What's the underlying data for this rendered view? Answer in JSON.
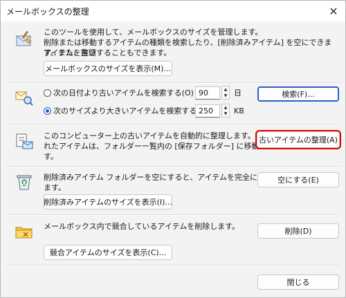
{
  "window": {
    "title": "メールボックスの整理",
    "close_glyph": "✕"
  },
  "sections": {
    "mailbox": {
      "line1": "このツールを使用して、メールボックスのサイズを管理します。",
      "line2": "削除または移動するアイテムの種類を検索したり、[削除済みアイテム] を空にできます。また、古い",
      "line3": "アイテムを整理することもできます。",
      "view_size_button": "メールボックスのサイズを表示(M)..."
    },
    "search": {
      "option_date": "次の日付より古いアイテムを検索する(O)",
      "date_value": "90",
      "date_unit": "日",
      "option_size": "次のサイズより大きいアイテムを検索する(L)",
      "size_value": "250",
      "size_unit": "KB",
      "selected": "size",
      "search_button": "検索(F)..."
    },
    "autoarchive": {
      "line1": "このコンピューター上の古いアイテムを自動的に整理します。整理さ",
      "line2": "れたアイテムは、フォルダー一覧内の [保存フォルダー] に移動しま",
      "line3": "す。",
      "button": "古いアイテムの整理(A)"
    },
    "deleted": {
      "line1": "削除済みアイテム フォルダーを空にすると、アイテムを完全に削除し",
      "line2": "ます。",
      "empty_button": "空にする(E)",
      "view_size_button": "削除済みアイテムのサイズを表示(I)..."
    },
    "conflicts": {
      "line1": "メールボックス内で競合しているアイテムを削除します。",
      "delete_button": "削除(D)",
      "view_size_button": "競合アイテムのサイズを表示(C)..."
    }
  },
  "footer": {
    "close_button": "閉じる"
  },
  "icons": {
    "mailbox": "mailbox-cleanup-icon",
    "search": "find-items-icon",
    "archive": "autoarchive-icon",
    "recycle": "recycle-bin-icon",
    "conflict": "conflict-folder-icon"
  }
}
